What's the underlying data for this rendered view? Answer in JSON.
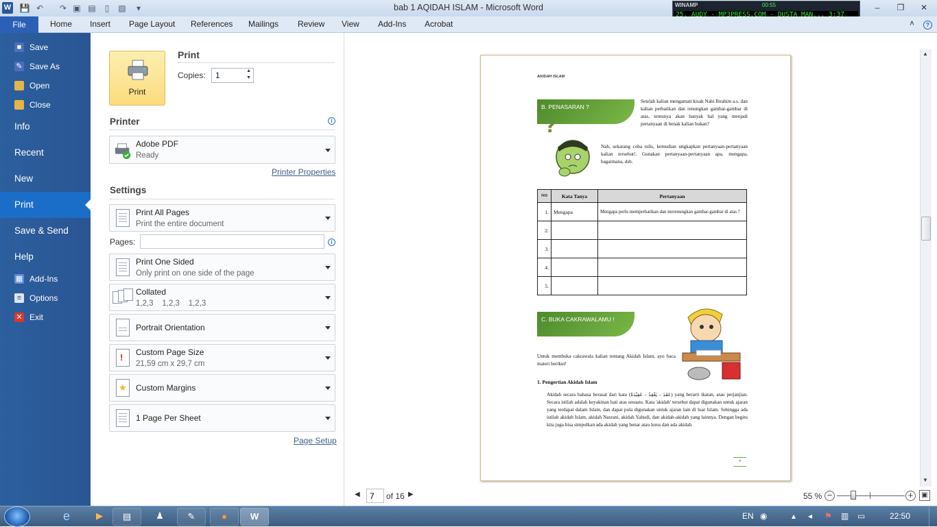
{
  "window": {
    "title": "bab 1 AQIDAH ISLAM  -  Microsoft Word",
    "word_logo": "W"
  },
  "winamp": {
    "title": "WINAMP",
    "time": "00:55",
    "track": "25. AUDY - MP3PRESS.COM - DUSTA MAN... 3:37"
  },
  "ribbon": {
    "tabs": [
      "File",
      "Home",
      "Insert",
      "Page Layout",
      "References",
      "Mailings",
      "Review",
      "View",
      "Add-Ins",
      "Acrobat"
    ]
  },
  "nav": {
    "save": "Save",
    "save_as": "Save As",
    "open": "Open",
    "close": "Close",
    "info": "Info",
    "recent": "Recent",
    "new": "New",
    "print": "Print",
    "save_send": "Save & Send",
    "help": "Help",
    "add_ins": "Add-Ins",
    "options": "Options",
    "exit": "Exit"
  },
  "print": {
    "heading": "Print",
    "button_label": "Print",
    "copies_label": "Copies:",
    "copies_value": "1"
  },
  "printer": {
    "heading": "Printer",
    "name": "Adobe PDF",
    "status": "Ready",
    "properties_link": "Printer Properties"
  },
  "settings": {
    "heading": "Settings",
    "print_range": {
      "title": "Print All Pages",
      "subtitle": "Print the entire document"
    },
    "pages_label": "Pages:",
    "pages_value": "",
    "sides": {
      "title": "Print One Sided",
      "subtitle": "Only print on one side of the page"
    },
    "collation": {
      "title": "Collated",
      "subtitle": "1,2,3    1,2,3    1,2,3"
    },
    "orientation": {
      "title": "Portrait Orientation"
    },
    "page_size": {
      "title": "Custom Page Size",
      "subtitle": "21,59 cm x 29,7 cm"
    },
    "margins": {
      "title": "Custom Margins"
    },
    "per_sheet": {
      "title": "1 Page Per Sheet"
    },
    "page_setup_link": "Page Setup"
  },
  "document": {
    "header": "AKIDAH ISLAM",
    "banner1": "B.  PENASARAN ?",
    "para1": "Setelah kalian mengamati kisah Nabi Ibrahim a.s. dan kalian perhatikan dan renungkan gambar-gambar di atas, tentunya akan banyak hal yang menjadi pertanyaan di benak kalian bukan?",
    "para2": "Nah, sekarang coba tulis, kemudian ungkapkan pertanyaan-pertanyaan kalian tersebut!. Gunakan pertanyaan-pertanyaan apa, mengapa, bagaimana, dsb.",
    "table": {
      "headers": [
        "NO",
        "Kata Tanya",
        "Pertanyaan"
      ],
      "rows": [
        [
          "1.",
          "Mengapa",
          "Mengapa perlu memperhatikan dan merenungkan gambar-gambar di atas ?"
        ],
        [
          "2.",
          "",
          ""
        ],
        [
          "3.",
          "",
          ""
        ],
        [
          "4.",
          "",
          ""
        ],
        [
          "5.",
          "",
          ""
        ]
      ]
    },
    "banner2": "C.  BUKA CAKRAWALAMU !",
    "para3": "Untuk membuka cakrawala kalian tentang Akidah Islam, ayo baca materi berikut!",
    "subheading": "1.  Pengertian Akidah Islam",
    "para4": "Akidah secara bahasa berasal dari kata (عَقَدَ - يَعْقِدُ - عَقِيْدَةً) yang berarti ikatan, atau perjanjian. Secara istilah adalah keyakinan hati atas sesuatu. Kata 'akidah' tersebut dapat digunakan untuk ajaran yang terdapat dalam Islam, dan dapat pula digunakan untuk ajaran lain di luar Islam. Sehingga ada istilah akidah Islam, akidah Nasrani, akidah Yahudi, dan akidah-akidah yang lainnya. Dengan begitu kita juga bisa simpulkan ada akidah yang benar atau lurus dan ada akidah",
    "page_number": "7"
  },
  "pagenav": {
    "current_page": "7",
    "of_total": "of 16"
  },
  "zoom": {
    "level": "55 %",
    "fraction": 0.55
  },
  "taskbar": {
    "lang": "EN",
    "clock": "22:50"
  },
  "colors": {
    "backstage_blue": "#2a5593",
    "active_nav": "#1b6ec8",
    "print_button": "#fcdc7c",
    "banner_green": "#6aa83a"
  }
}
